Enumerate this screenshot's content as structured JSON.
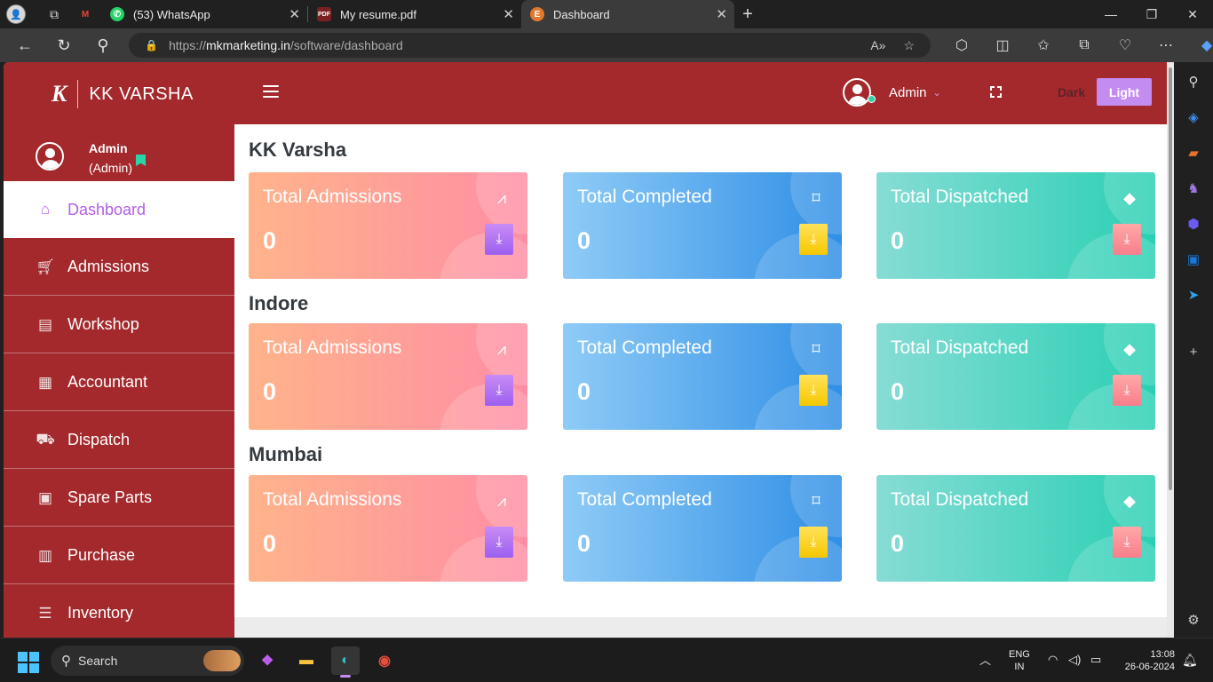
{
  "browser": {
    "tabs": [
      {
        "title": "(53) WhatsApp"
      },
      {
        "title": "My resume.pdf"
      },
      {
        "title": "Dashboard"
      }
    ],
    "url_prefix": "https://",
    "url_domain": "mkmarketing.in",
    "url_path": "/software/dashboard"
  },
  "header": {
    "logo_mark": "K",
    "logo_text": "KK VARSHA",
    "user_name": "Admin",
    "theme_dark": "Dark",
    "theme_light": "Light"
  },
  "sidebar": {
    "user_name": "Admin",
    "user_role": "(Admin)",
    "items": [
      {
        "label": "Dashboard",
        "icon": "home-icon"
      },
      {
        "label": "Admissions",
        "icon": "cart-icon"
      },
      {
        "label": "Workshop",
        "icon": "store-icon"
      },
      {
        "label": "Accountant",
        "icon": "document-icon"
      },
      {
        "label": "Dispatch",
        "icon": "truck-icon"
      },
      {
        "label": "Spare Parts",
        "icon": "camera-icon"
      },
      {
        "label": "Purchase",
        "icon": "bar-chart-icon"
      },
      {
        "label": "Inventory",
        "icon": "list-icon"
      }
    ]
  },
  "sections": [
    {
      "title": "KK Varsha",
      "cards": [
        {
          "label": "Total Admissions",
          "value": "0"
        },
        {
          "label": "Total Completed",
          "value": "0"
        },
        {
          "label": "Total Dispatched",
          "value": "0"
        }
      ]
    },
    {
      "title": "Indore",
      "cards": [
        {
          "label": "Total Admissions",
          "value": "0"
        },
        {
          "label": "Total Completed",
          "value": "0"
        },
        {
          "label": "Total Dispatched",
          "value": "0"
        }
      ]
    },
    {
      "title": "Mumbai",
      "cards": [
        {
          "label": "Total Admissions",
          "value": "0"
        },
        {
          "label": "Total Completed",
          "value": "0"
        },
        {
          "label": "Total Dispatched",
          "value": "0"
        }
      ]
    }
  ],
  "taskbar": {
    "search_placeholder": "Search",
    "lang_top": "ENG",
    "lang_bottom": "IN",
    "time": "13:08",
    "date": "26-06-2024"
  },
  "colors": {
    "brand": "#a3292d",
    "accent": "#c38cf1",
    "card_pink": "#ff8ea5",
    "card_blue": "#2f8fe6",
    "card_teal": "#2ad0b4"
  }
}
